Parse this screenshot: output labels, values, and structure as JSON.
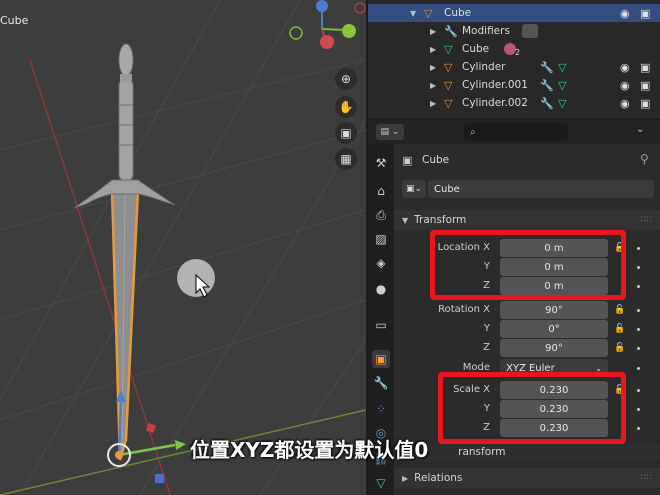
{
  "viewport": {
    "object_label": "Cube",
    "nav": [
      "zoom-icon",
      "hand-icon",
      "camera-icon",
      "grid-icon"
    ],
    "gizmo": {
      "z": "Z",
      "y": "Y",
      "x": "X"
    }
  },
  "outliner": {
    "rows": [
      {
        "name": "Cube",
        "selected": true
      },
      {
        "name": "Modifiers"
      },
      {
        "name": "Cube",
        "badge": "2"
      },
      {
        "name": "Cylinder"
      },
      {
        "name": "Cylinder.001"
      },
      {
        "name": "Cylinder.002"
      }
    ]
  },
  "properties": {
    "object_name": "Cube",
    "object_field": "Cube",
    "transform_label": "Transform",
    "location": {
      "label_x": "Location X",
      "label_y": "Y",
      "label_z": "Z",
      "x": "0 m",
      "y": "0 m",
      "z": "0 m"
    },
    "rotation": {
      "label_x": "Rotation X",
      "label_y": "Y",
      "label_z": "Z",
      "x": "90°",
      "y": "0°",
      "z": "90°"
    },
    "mode": {
      "label": "Mode",
      "value": "XYZ Euler"
    },
    "scale": {
      "label_x": "Scale X",
      "label_y": "Y",
      "label_z": "Z",
      "x": "0.230",
      "y": "0.230",
      "z": "0.230"
    },
    "delta_transform": "ransform",
    "relations": "Relations"
  },
  "caption": "位置XYZ都设置为默认值0",
  "colors": {
    "selection": "#334d80",
    "highlight_box": "#e8161d",
    "accent_orange": "#e8913a"
  }
}
